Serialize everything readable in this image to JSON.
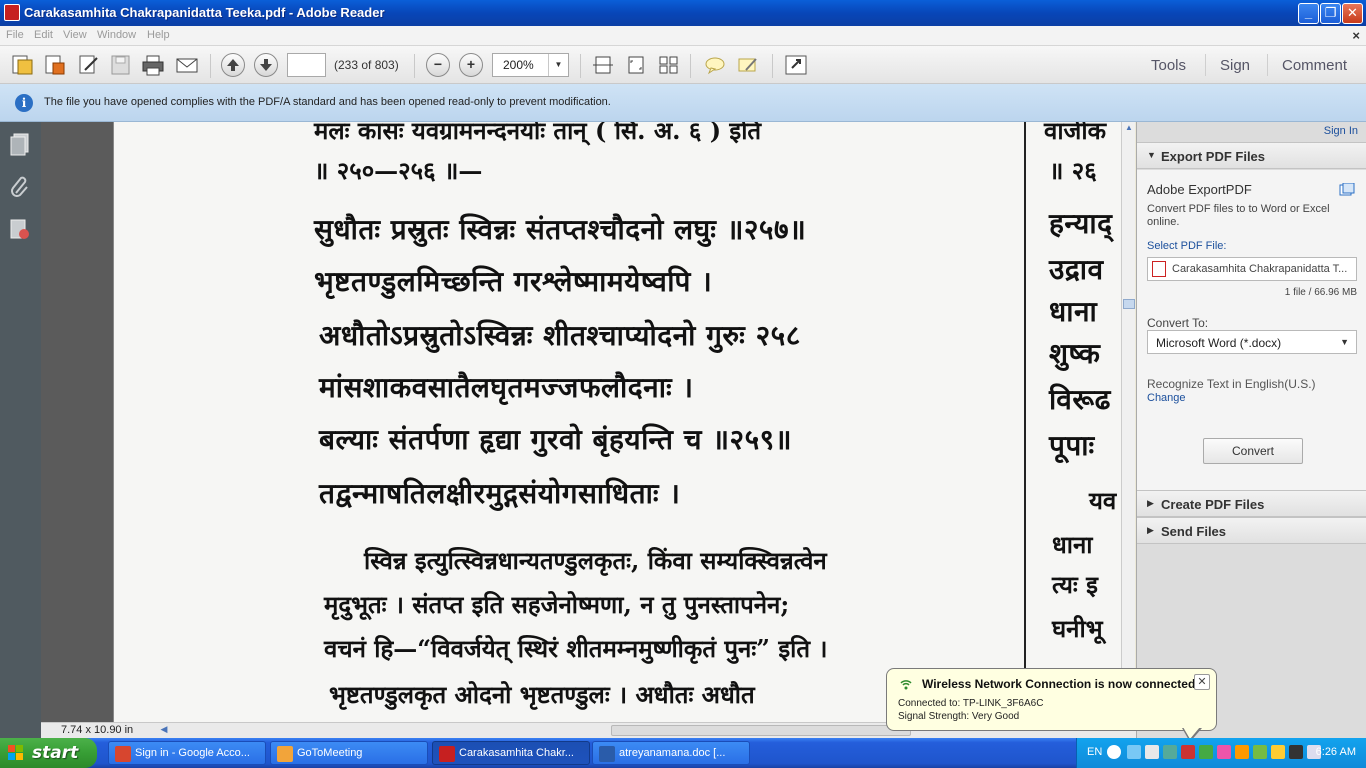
{
  "window": {
    "title": "Carakasamhita Chakrapanidatta Teeka.pdf - Adobe Reader",
    "min_label": "_",
    "max_label": "❐",
    "close_label": "✕"
  },
  "menu": {
    "items": [
      "File",
      "Edit",
      "View",
      "Window",
      "Help"
    ],
    "close_label": "×"
  },
  "toolbar": {
    "page_input": "",
    "page_count": "(233 of 803)",
    "zoom": "200%",
    "zoom_out_label": "−",
    "zoom_in_label": "+",
    "tools_label": "Tools",
    "sign_label": "Sign",
    "comment_label": "Comment"
  },
  "infobar": {
    "message": "The file you have opened complies with the PDF/A standard and has been opened read-only to prevent modification."
  },
  "document": {
    "lines": [
      "मलः कासः यवग्रामनन्दनयोः तान् ( सि. अ. ६ ) इति",
      "॥ २५०—२५६ ॥—",
      "सुधौतः प्रस्रुतः स्विन्नः संतप्तश्चौदनो लघुः ॥२५७॥",
      "भृष्टतण्डुलमिच्छन्ति गरश्लेष्मामयेष्वपि ।",
      "अधौतोऽप्रस्रुतोऽस्विन्नः शीतश्चाप्योदनो गुरुः २५८",
      "मांसशाकवसातैलघृतमज्जफलौदनाः ।",
      "बल्याः संतर्पणा हृद्या गुरवो बृंहयन्ति च ॥२५९॥",
      "तद्वन्माषतिलक्षीरमुद्गसंयोगसाधिताः ।",
      "स्विन्न इत्युत्स्विन्नधान्यतण्डुलकृतः, किंवा सम्यक्स्विन्नत्वेन",
      "मृदुभूतः । संतप्त इति सहजेनोष्मणा, न तु पुनस्तापनेन;",
      "वचनं हि—“विवर्जयेत् स्थिरं शीतमम्नमुष्णीकृतं पुनः” इति ।",
      "भृष्टतण्डुलकृत ओदनो भृष्टतण्डुलः । अधौतः अधौत"
    ],
    "right_column": [
      "वाजीक",
      "॥ २६",
      "हन्याद्",
      "उद्राव",
      "धाना",
      "शुष्क",
      "विरूढ",
      "पूपाः",
      "यव",
      "धाना",
      "त्यः इ",
      "घनीभू"
    ],
    "page_size": "7.74 x 10.90 in"
  },
  "right_panel": {
    "sign_in": "Sign In",
    "export_header": "Export PDF Files",
    "export_title": "Adobe ExportPDF",
    "export_desc": "Convert PDF files to to Word or Excel online.",
    "select_label": "Select PDF File:",
    "file_name": "Carakasamhita Chakrapanidatta T...",
    "file_info": "1 file / 66.96 MB",
    "convert_to_label": "Convert To:",
    "convert_to_value": "Microsoft Word (*.docx)",
    "recognize_text": "Recognize Text in English(U.S.)",
    "change_label": "Change",
    "convert_button": "Convert",
    "create_header": "Create PDF Files",
    "send_header": "Send Files"
  },
  "balloon": {
    "title": "Wireless Network Connection is now connected",
    "line1": "Connected to: TP-LINK_3F6A6C",
    "line2": "Signal Strength: Very Good",
    "close_label": "✕"
  },
  "taskbar": {
    "start_label": "start",
    "tasks": [
      {
        "label": "Sign in - Google Acco...",
        "icon_color": "#d7462f"
      },
      {
        "label": "GoToMeeting",
        "icon_color": "#f2a43a"
      },
      {
        "label": "Carakasamhita Chakr...",
        "icon_color": "#c62020"
      },
      {
        "label": "atreyanamana.doc [...",
        "icon_color": "#2a5caa"
      }
    ],
    "lang": "EN",
    "clock": "6:26 AM"
  }
}
